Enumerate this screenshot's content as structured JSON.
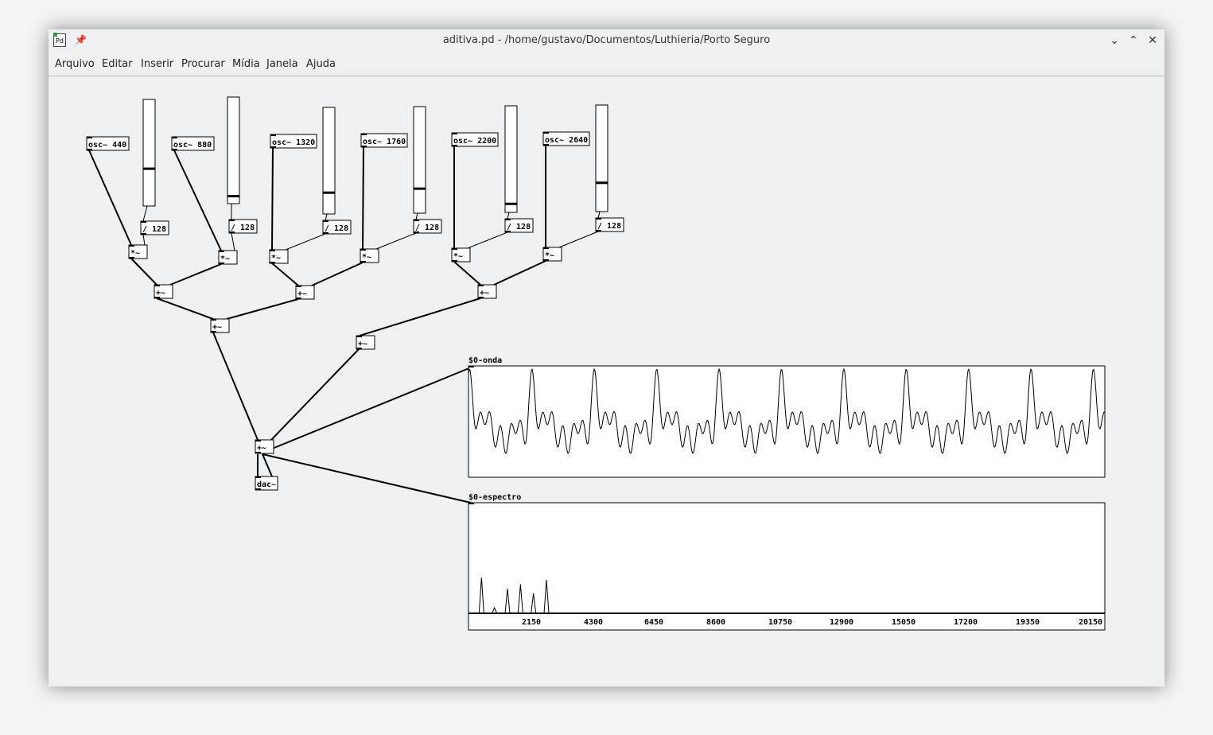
{
  "window": {
    "title": "aditiva.pd - /home/gustavo/Documentos/Luthieria/Porto Seguro",
    "logo_text": "Pd",
    "buttons": [
      "minimize-icon",
      "maximize-icon",
      "close-icon"
    ]
  },
  "menu": {
    "items": [
      "Arquivo",
      "Editar",
      "Inserir",
      "Procurar",
      "Mídia",
      "Janela",
      "Ajuda"
    ]
  },
  "patch": {
    "oscillators": [
      "osc~ 440",
      "osc~ 880",
      "osc~ 1320",
      "osc~ 1760",
      "osc~ 2200",
      "osc~ 2640"
    ],
    "dividers": [
      "/ 128",
      "/ 128",
      "/ 128",
      "/ 128",
      "/ 128",
      "/ 128"
    ],
    "slider_levels": [
      0.35,
      0.07,
      0.2,
      0.23,
      0.08,
      0.27
    ],
    "multiply_label": "*~",
    "add_label": "+~",
    "dac_label": "dac~"
  },
  "graphs": {
    "wave": {
      "label": "$0-onda",
      "color": "#000000"
    },
    "spectrum": {
      "label": "$0-espectro",
      "x_ticks": [
        "2150",
        "4300",
        "6450",
        "8600",
        "10750",
        "12900",
        "15050",
        "17200",
        "19350",
        "20150"
      ],
      "peaks": [
        {
          "x": 440,
          "y": 0.32
        },
        {
          "x": 880,
          "y": 0.05
        },
        {
          "x": 1320,
          "y": 0.22
        },
        {
          "x": 1760,
          "y": 0.26
        },
        {
          "x": 2200,
          "y": 0.18
        },
        {
          "x": 2640,
          "y": 0.3
        }
      ],
      "x_range": [
        0,
        21550
      ]
    }
  }
}
